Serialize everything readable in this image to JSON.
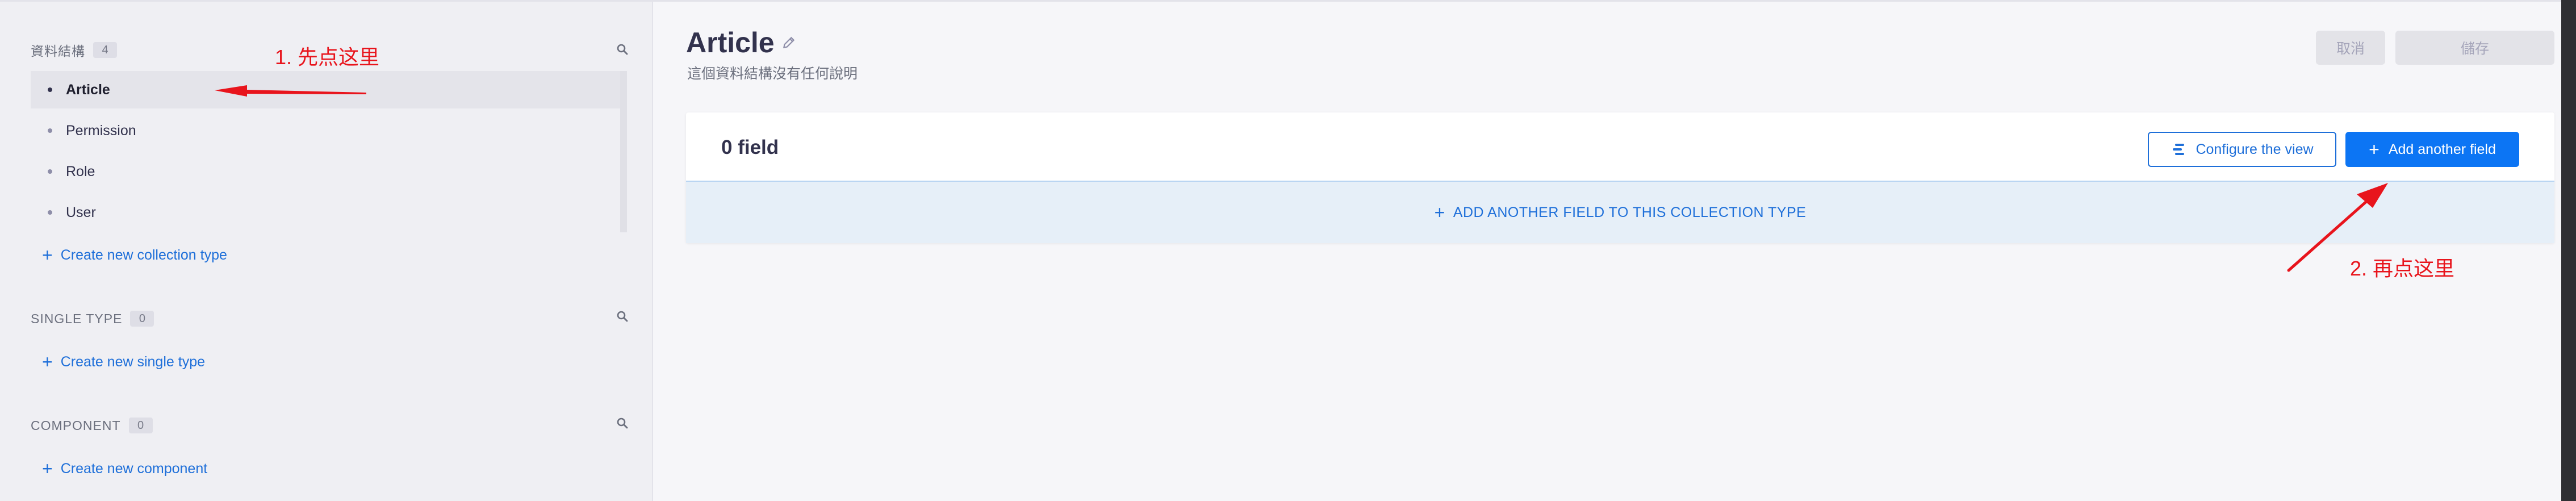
{
  "sidebar": {
    "collection": {
      "title": "資料結構",
      "count": "4"
    },
    "items": [
      {
        "label": "Article"
      },
      {
        "label": "Permission"
      },
      {
        "label": "Role"
      },
      {
        "label": "User"
      }
    ],
    "create_collection": "Create new collection type",
    "single": {
      "title": "SINGLE TYPE",
      "count": "0"
    },
    "create_single": "Create new single type",
    "component": {
      "title": "COMPONENT",
      "count": "0"
    },
    "create_component": "Create new component"
  },
  "main": {
    "title": "Article",
    "subtitle": "這個資料結構沒有任何說明",
    "cancel_label": "取消",
    "save_label": "儲存",
    "field_count": "0 field",
    "configure_label": "Configure the view",
    "add_field_label": "Add another field",
    "add_row_label": "ADD ANOTHER FIELD TO THIS COLLECTION TYPE"
  },
  "annotations": {
    "step1": "1. 先点这里",
    "step2": "2. 再点这里",
    "color": "#e8141c"
  },
  "colors": {
    "accent": "#0c75f4",
    "link": "#1e6fd9"
  },
  "icons": [
    "search-icon",
    "pencil-icon",
    "plus-icon",
    "configure-icon"
  ]
}
